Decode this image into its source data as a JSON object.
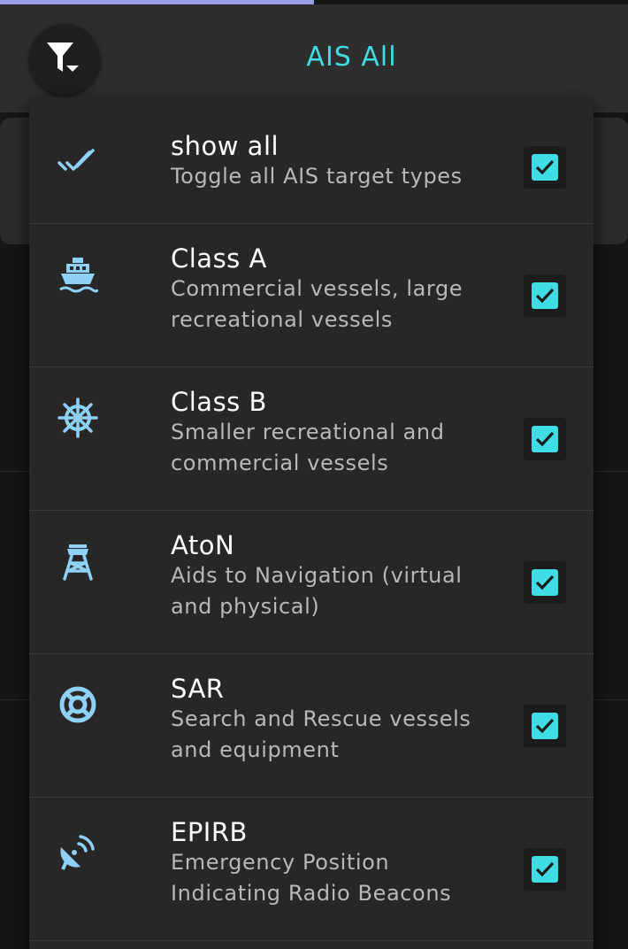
{
  "header": {
    "title": "AIS All"
  },
  "colors": {
    "accent": "#3fdce4",
    "icon": "#8fd0f7",
    "panel": "#272727"
  },
  "filter_menu": {
    "items": [
      {
        "title": "show all",
        "description": "Toggle all AIS target types",
        "icon": "double-check-icon",
        "checked": true
      },
      {
        "title": "Class A",
        "description": "Commercial vessels, large recreational vessels",
        "icon": "ship-icon",
        "checked": true
      },
      {
        "title": "Class B",
        "description": "Smaller recreational and commercial vessels",
        "icon": "ship-wheel-icon",
        "checked": true
      },
      {
        "title": "AtoN",
        "description": "Aids to Navigation (virtual and physical)",
        "icon": "lighthouse-tower-icon",
        "checked": true
      },
      {
        "title": "SAR",
        "description": "Search and Rescue vessels and equipment",
        "icon": "lifebuoy-icon",
        "checked": true
      },
      {
        "title": "EPIRB",
        "description": "Emergency Position Indicating Radio Beacons",
        "icon": "satellite-dish-icon",
        "checked": true
      }
    ]
  }
}
